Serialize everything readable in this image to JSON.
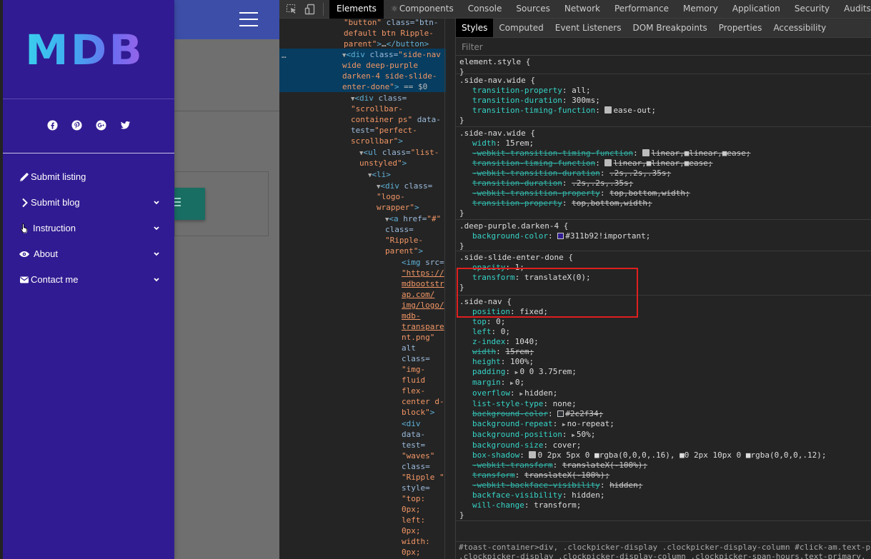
{
  "app": {
    "logo_text": "MDB",
    "social": [
      "facebook-icon",
      "pinterest-icon",
      "google-plus-icon",
      "twitter-icon"
    ],
    "nav": [
      {
        "label": "Submit listing",
        "icon": "pencil-icon",
        "has_chevron": false
      },
      {
        "label": "Submit blog",
        "icon": "chevron-right-icon",
        "has_chevron": true
      },
      {
        "label": "Instruction",
        "icon": "hand-cursor-icon",
        "has_chevron": true
      },
      {
        "label": "About",
        "icon": "eye-icon",
        "has_chevron": true
      },
      {
        "label": "Contact me",
        "icon": "envelope-icon",
        "has_chevron": true
      }
    ],
    "colors": {
      "sidenav": "#311b92",
      "navbar": "#3c4ea8",
      "teal_button": "#196e63"
    }
  },
  "devtools": {
    "tabs": [
      "Elements",
      "Components",
      "Console",
      "Sources",
      "Network",
      "Performance",
      "Memory",
      "Application",
      "Security",
      "Audits"
    ],
    "active_tab": "Elements",
    "subtabs": [
      "Styles",
      "Computed",
      "Event Listeners",
      "DOM Breakpoints",
      "Properties",
      "Accessibility"
    ],
    "active_subtab": "Styles",
    "filter_placeholder": "Filter",
    "elements": {
      "l1a": "\"button\"",
      "l1b": "class=\"btn-",
      "l2": "default btn Ripple-",
      "l3": "parent\">…</button>",
      "l4_dots": "…",
      "l4_tag": "<div ",
      "l4_attr": "class=",
      "l4_val": "\"side-nav",
      "l5": "wide deep-purple",
      "l6": "darken-4 side-slide-",
      "l7_val": "enter-done\"",
      "l7_tag": ">",
      "l7_eq": " == $0",
      "l8_tag": "<div ",
      "l8_attr": "class=",
      "l9": "\"scrollbar-",
      "l10_val": "container ps\"",
      "l10_attr": " data-",
      "l11_attr": "test=",
      "l11_val": "\"perfect-",
      "l12_val": "scrollbar\"",
      "l12_tag": ">",
      "l13_tag": "<ul ",
      "l13_attr": "class=",
      "l13_val": "\"list-",
      "l14_val": "unstyled\"",
      "l14_tag": ">",
      "l15_tag": "<li>",
      "l16_tag": "<div ",
      "l16_attr": "class=",
      "l17": "\"logo-",
      "l18_val": "wrapper\"",
      "l18_tag": ">",
      "l19_tag": "<a ",
      "l19_attr": "href=",
      "l19_val": "\"#\"",
      "l20": "class=",
      "l21": "\"Ripple-",
      "l22_val": "parent\"",
      "l22_tag": ">",
      "l23_tag": "<img ",
      "l23_attr": "src=",
      "l24": "\"https://",
      "l25": "mdbootstr",
      "l26": "ap.com/",
      "l27": "img/logo/",
      "l28": "mdb-",
      "l29": "transpare",
      "l30": "nt.png\"",
      "l31": "alt",
      "l32": "class=",
      "l33": "\"img-",
      "l34": "fluid",
      "l35": "flex-",
      "l36": "center d-",
      "l37_val": "block\"",
      "l37_tag": ">",
      "l38": "<div",
      "l39": "data-",
      "l40": "test=",
      "l41": "\"waves\"",
      "l42": "class=",
      "l43": "\"Ripple \"",
      "l44": "style=",
      "l45": "\"top:",
      "l46": "0px;",
      "l47": "left:",
      "l48": "0px;",
      "l49": "width:",
      "l50": "0px;"
    },
    "rules": [
      {
        "selector": "element.style {",
        "decls": []
      },
      {
        "selector": ".side-nav.wide {",
        "decls": [
          {
            "p": "transition-property",
            "v": "all;",
            "struck": false
          },
          {
            "p": "transition-duration",
            "v": "300ms;",
            "struck": false
          },
          {
            "p": "transition-timing-function",
            "v": "ease-out;",
            "struck": false,
            "ease": true
          }
        ]
      },
      {
        "selector": ".side-nav.wide {",
        "decls": [
          {
            "p": "width",
            "v": "15rem;",
            "struck": false
          },
          {
            "p": "-webkit-transition-timing-function",
            "v": "linear,■linear,■ease;",
            "struck": true,
            "ease": true
          },
          {
            "p": "transition-timing-function",
            "v": "linear,■linear,■ease;",
            "struck": true,
            "ease": true
          },
          {
            "p": "-webkit-transition-duration",
            "v": ".2s,.2s,.35s;",
            "struck": true
          },
          {
            "p": "transition-duration",
            "v": ".2s,.2s,.35s;",
            "struck": true
          },
          {
            "p": "-webkit-transition-property",
            "v": "top,bottom,width;",
            "struck": true
          },
          {
            "p": "transition-property",
            "v": "top,bottom,width;",
            "struck": true
          }
        ]
      },
      {
        "selector": ".deep-purple.darken-4 {",
        "decls": [
          {
            "p": "background-color",
            "v": "#311b92!important;",
            "struck": false,
            "swatch": "#311b92"
          }
        ]
      },
      {
        "selector": ".side-slide-enter-done {",
        "decls": [
          {
            "p": "opacity",
            "v": "1;",
            "struck": false
          },
          {
            "p": "transform",
            "v": "translateX(0);",
            "struck": false
          }
        ]
      },
      {
        "selector": ".side-nav {",
        "decls": [
          {
            "p": "position",
            "v": "fixed;",
            "struck": false
          },
          {
            "p": "top",
            "v": "0;",
            "struck": false
          },
          {
            "p": "left",
            "v": "0;",
            "struck": false
          },
          {
            "p": "z-index",
            "v": "1040;",
            "struck": false
          },
          {
            "p": "width",
            "v": "15rem;",
            "struck": true
          },
          {
            "p": "height",
            "v": "100%;",
            "struck": false
          },
          {
            "p": "padding",
            "v": "0 0 3.75rem;",
            "struck": false,
            "expand": true
          },
          {
            "p": "margin",
            "v": "0;",
            "struck": false,
            "expand": true
          },
          {
            "p": "overflow",
            "v": "hidden;",
            "struck": false,
            "expand": true
          },
          {
            "p": "list-style-type",
            "v": "none;",
            "struck": false
          },
          {
            "p": "background-color",
            "v": "#2c2f34;",
            "struck": true,
            "swatch": "#2c2f34"
          },
          {
            "p": "background-repeat",
            "v": "no-repeat;",
            "struck": false,
            "expand": true
          },
          {
            "p": "background-position",
            "v": "50%;",
            "struck": false,
            "expand": true
          },
          {
            "p": "background-size",
            "v": "cover;",
            "struck": false
          },
          {
            "p": "box-shadow",
            "v": "0 2px 5px 0 ■rgba(0,0,0,.16), ■0 2px 10px 0 ■rgba(0,0,0,.12);",
            "struck": false,
            "shadow": true
          },
          {
            "p": "-webkit-transform",
            "v": "translateX(-100%);",
            "struck": true
          },
          {
            "p": "transform",
            "v": "translateX(-100%);",
            "struck": true
          },
          {
            "p": "-webkit-backface-visibility",
            "v": "hidden;",
            "struck": true
          },
          {
            "p": "backface-visibility",
            "v": "hidden;",
            "struck": false
          },
          {
            "p": "will-change",
            "v": "transform;",
            "struck": false
          }
        ]
      }
    ],
    "footer_line1": "#toast-container>div, .clockpicker-display .clockpicker-display-column #click-am.text-p",
    "footer_line2": ".clockpicker-display .clockpicker-display-column .clockpicker-span-hours.text-primary,"
  }
}
